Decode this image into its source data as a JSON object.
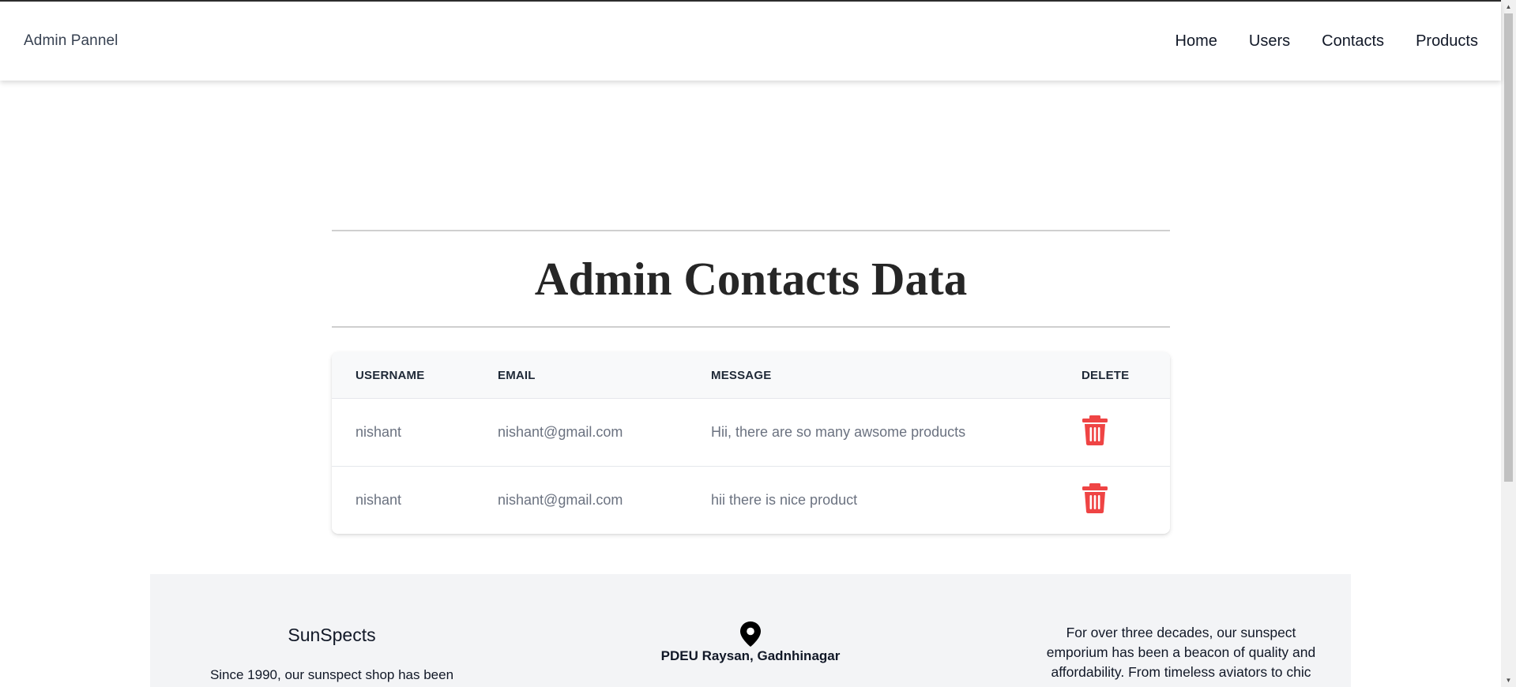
{
  "navbar": {
    "brand": "Admin Pannel",
    "links": [
      "Home",
      "Users",
      "Contacts",
      "Products"
    ]
  },
  "page": {
    "title": "Admin Contacts Data"
  },
  "table": {
    "headers": [
      "USERNAME",
      "EMAIL",
      "MESSAGE",
      "DELETE"
    ],
    "rows": [
      {
        "username": "nishant",
        "email": "nishant@gmail.com",
        "message": "Hii, there are so many awsome products"
      },
      {
        "username": "nishant",
        "email": "nishant@gmail.com",
        "message": "hii there is nice product"
      }
    ],
    "delete_icon": "trash-icon",
    "delete_color": "#ef4444"
  },
  "footer": {
    "brand": "SunSpects",
    "description": "Since 1990, our sunspect shop has been",
    "address_icon": "map-pin-icon",
    "address": "PDEU Raysan, Gadnhinagar",
    "about_lines": [
      "For over three decades, our sunspect",
      "emporium has been a beacon of quality and",
      "affordability. From timeless aviators to chic"
    ]
  },
  "colors": {
    "background": "#ffffff",
    "footer_bg": "#f3f4f6",
    "table_header_bg": "#f8f9fa",
    "danger": "#ef4444"
  }
}
